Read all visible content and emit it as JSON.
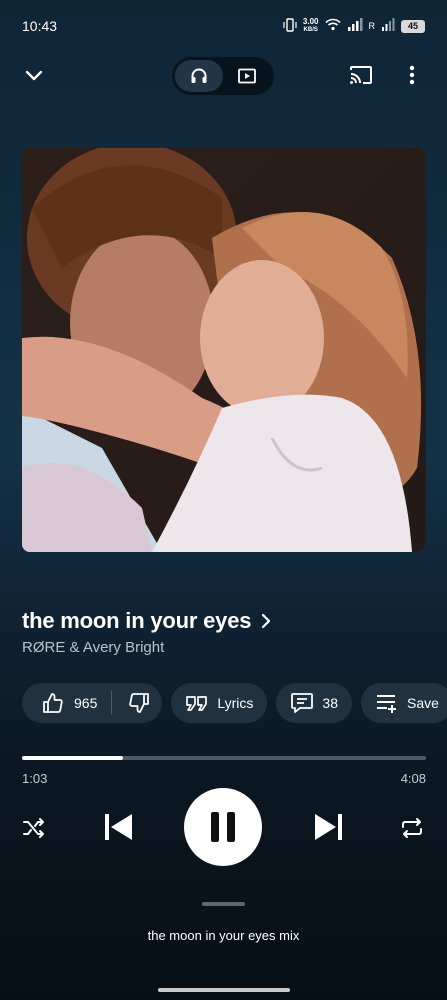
{
  "status_bar": {
    "time": "10:43",
    "net_speed_value": "3.00",
    "net_speed_unit": "KB/S",
    "roaming": "R",
    "battery": "45"
  },
  "top_bar": {
    "collapse_icon": "chevron-down-icon",
    "toggle_options": [
      "audio",
      "video"
    ],
    "selected_mode": "audio",
    "cast_icon": "cast-icon",
    "more_icon": "more-vert-icon"
  },
  "song": {
    "title": "the moon in your eyes",
    "artist": "RØRE & Avery Bright"
  },
  "actions": {
    "like_count": "965",
    "lyrics_label": "Lyrics",
    "comments_count": "38",
    "save_label": "Save"
  },
  "player": {
    "elapsed": "1:03",
    "duration": "4:08",
    "progress_fraction": 0.25,
    "state": "playing"
  },
  "queue": {
    "up_next_label": "the moon in your eyes mix"
  },
  "colors": {
    "background_top": "#0e2536",
    "background_bottom": "#070f16",
    "pill_bg": "#20313f",
    "accent": "#ffffff"
  }
}
